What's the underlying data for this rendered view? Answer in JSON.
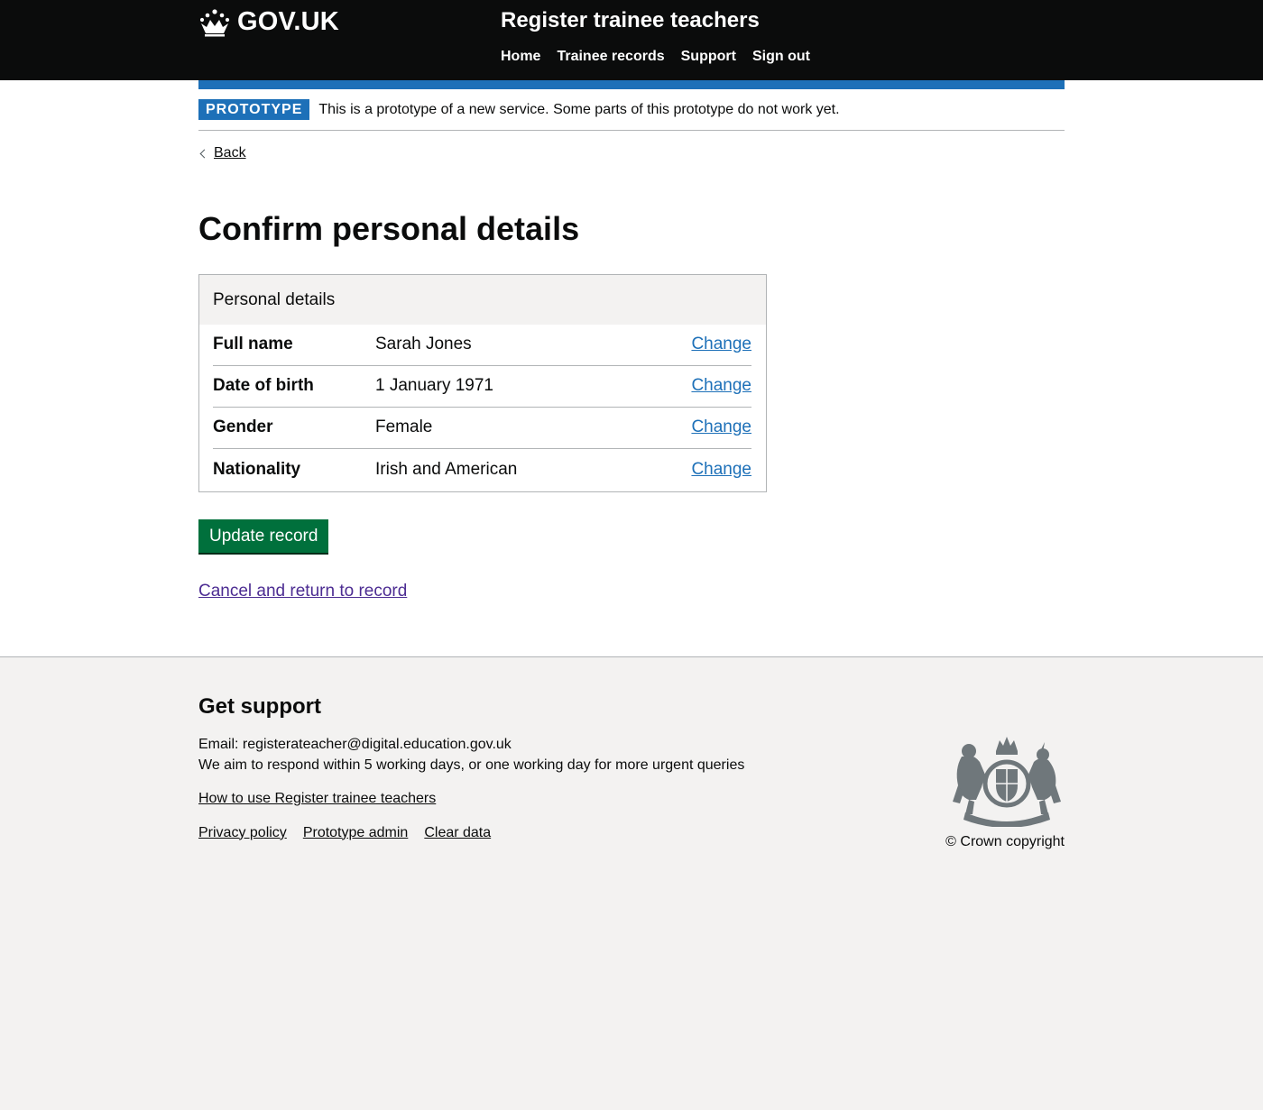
{
  "header": {
    "logo_text": "GOV.UK",
    "service_name": "Register trainee teachers",
    "nav": [
      "Home",
      "Trainee records",
      "Support",
      "Sign out"
    ]
  },
  "phase_banner": {
    "tag": "PROTOTYPE",
    "text": "This is a prototype of a new service. Some parts of this prototype do not work yet."
  },
  "back_link": "Back",
  "page_title": "Confirm personal details",
  "summary_card": {
    "title": "Personal details",
    "rows": [
      {
        "key": "Full name",
        "value": "Sarah Jones",
        "action": "Change"
      },
      {
        "key": "Date of birth",
        "value": "1 January 1971",
        "action": "Change"
      },
      {
        "key": "Gender",
        "value": "Female",
        "action": "Change"
      },
      {
        "key": "Nationality",
        "value": "Irish and American",
        "action": "Change"
      }
    ]
  },
  "update_button": "Update record",
  "cancel_link": "Cancel and return to record",
  "footer": {
    "heading": "Get support",
    "email_label": "Email:",
    "email": "registerateacher@digital.education.gov.uk",
    "respond_text": "We aim to respond within 5 working days, or one working day for more urgent queries",
    "howto_link": "How to use Register trainee teachers",
    "links": [
      "Privacy policy",
      "Prototype admin",
      "Clear data"
    ],
    "copyright": "© Crown copyright"
  },
  "colors": {
    "header_bg": "#0b0c0c",
    "brand_blue": "#1d70b8",
    "button_green": "#00703c",
    "visited_link": "#4c2c92",
    "footer_bg": "#f3f2f1"
  },
  "icons": {
    "logo": "crown-icon",
    "back": "chevron-left-icon",
    "crest": "royal-coat-of-arms-icon"
  }
}
